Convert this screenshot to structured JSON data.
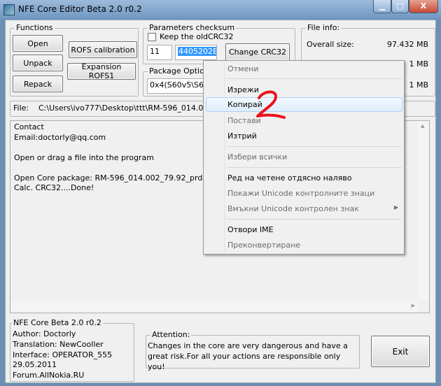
{
  "window": {
    "title": "NFE Core Editor Beta 2.0 r0.2",
    "minimize": "▁",
    "maximize": "□",
    "close": "X"
  },
  "functions": {
    "legend": "Functions",
    "open": "Open",
    "unpack": "Unpack",
    "repack": "Repack",
    "rofs_calibration": "ROFS calibration",
    "expansion_rofs1": "Expansion ROFS1"
  },
  "checksum": {
    "legend": "Parameters checksum",
    "keep_old": "Keep the oldCRC32",
    "keep_old_checked": false,
    "field1": "11",
    "crc_value": "4405202E",
    "change_button": "Change CRC32"
  },
  "package": {
    "legend": "Package Optio",
    "value": "0x4(S60v5\\S60"
  },
  "file_info": {
    "legend": "File info:",
    "rows": [
      {
        "label": "Overall size:",
        "value": "97.432  MB"
      },
      {
        "label": "",
        "value": "1  MB"
      },
      {
        "label": "",
        "value": "1  MB"
      }
    ]
  },
  "file": {
    "label": "File:",
    "path": "C:\\Users\\ivo777\\Desktop\\ttt\\RM-596_014.00"
  },
  "log": {
    "lines": [
      "Contact",
      "Email:doctorly@qq.com",
      "",
      "Open or drag a file into the program",
      "",
      "Open Core package:  RM-596_014.002_79.92_prd.co",
      "Calc. CRC32....Done!"
    ]
  },
  "about": {
    "legend": "NFE Core Beta 2.0 r0.2",
    "lines": [
      "Author: Doctorly",
      "Translation: NewCooller",
      "Interface: OPERATOR_555",
      "29.05.2011",
      "Forum.AllNokia.RU"
    ]
  },
  "attention": {
    "legend": "Attention:",
    "text": "Changes in the core are very dangerous and have a great risk.For all your actions are responsible only you!"
  },
  "exit": "Exit",
  "context_menu": {
    "items": [
      {
        "label": "Отмени",
        "enabled": false
      },
      {
        "label": "Изрежи",
        "enabled": true
      },
      {
        "label": "Копирай",
        "enabled": true,
        "highlighted": true
      },
      {
        "label": "Постави",
        "enabled": false
      },
      {
        "label": "Изтрий",
        "enabled": true
      },
      {
        "label": "Избери всички",
        "enabled": false
      },
      {
        "label": "Ред на четене отдясно наляво",
        "enabled": true
      },
      {
        "label": "Покажи Unicode контролните знаци",
        "enabled": false
      },
      {
        "label": "Вмъкни Unicode контролен знак",
        "enabled": false,
        "submenu": true
      },
      {
        "label": "Отвори IME",
        "enabled": true
      },
      {
        "label": "Преконвертиране",
        "enabled": false
      }
    ]
  },
  "annotation": {
    "text": "2",
    "color": "#e8141c"
  }
}
